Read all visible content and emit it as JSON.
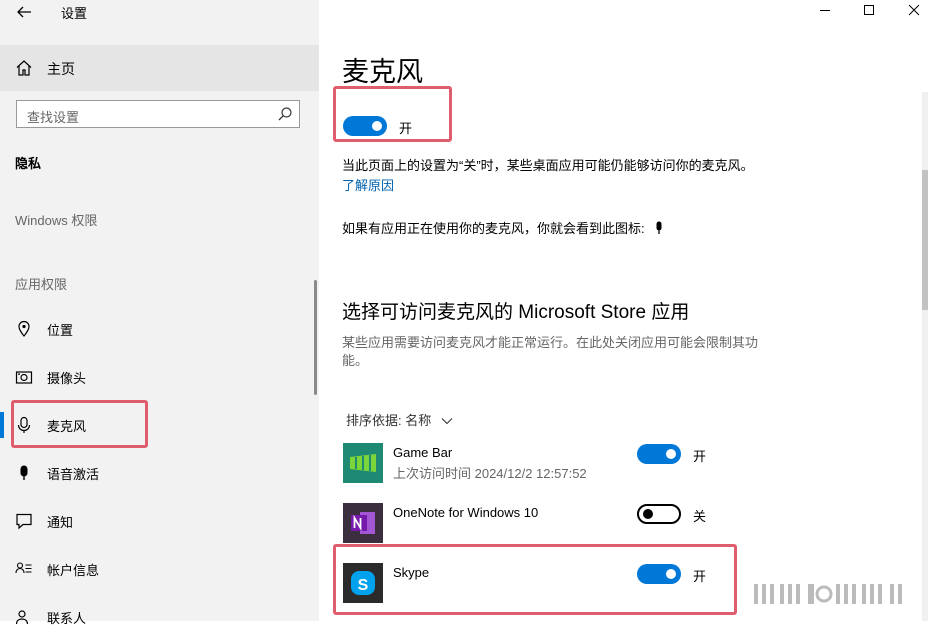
{
  "window": {
    "title": "设置",
    "minimize_glyph": "—",
    "maximize_glyph": "☐",
    "close_glyph": "✕"
  },
  "sidebar": {
    "home_label": "主页",
    "search_placeholder": "查找设置",
    "section_title": "隐私",
    "windows_permissions_label": "Windows 权限",
    "app_permissions_label": "应用权限",
    "items": [
      {
        "label": "位置",
        "icon": "location-icon"
      },
      {
        "label": "摄像头",
        "icon": "camera-icon"
      },
      {
        "label": "麦克风",
        "icon": "microphone-icon",
        "selected": true
      },
      {
        "label": "语音激活",
        "icon": "voice-activation-icon"
      },
      {
        "label": "通知",
        "icon": "notification-icon"
      },
      {
        "label": "帐户信息",
        "icon": "account-info-icon"
      },
      {
        "label": "联系人",
        "icon": "contacts-icon"
      }
    ]
  },
  "main": {
    "page_title": "麦克风",
    "master_toggle_state": "开",
    "description": "当此页面上的设置为“关”时，某些桌面应用可能仍能够访问你的麦克风。",
    "learn_more": "了解原因",
    "mic_icon_note": "如果有应用正在使用你的麦克风，你就会看到此图标:",
    "store_section_title": "选择可访问麦克风的 Microsoft Store 应用",
    "store_section_desc_line1": "某些应用需要访问麦克风才能正常运行。在此处关闭应用可能会限制其功",
    "store_section_desc_line2": "能。",
    "sort_label": "排序依据: 名称",
    "apps": [
      {
        "name": "Game Bar",
        "last_access": "上次访问时间 2024/12/2 12:57:52",
        "state": "开",
        "on": true
      },
      {
        "name": "OneNote for Windows 10",
        "state": "关",
        "on": false
      },
      {
        "name": "Skype",
        "state": "开",
        "on": true
      }
    ]
  },
  "colors": {
    "accent": "#0078d7",
    "highlight_box": "#e05d6e",
    "link": "#0063b1",
    "sidebar_bg": "#f2f2f2"
  }
}
